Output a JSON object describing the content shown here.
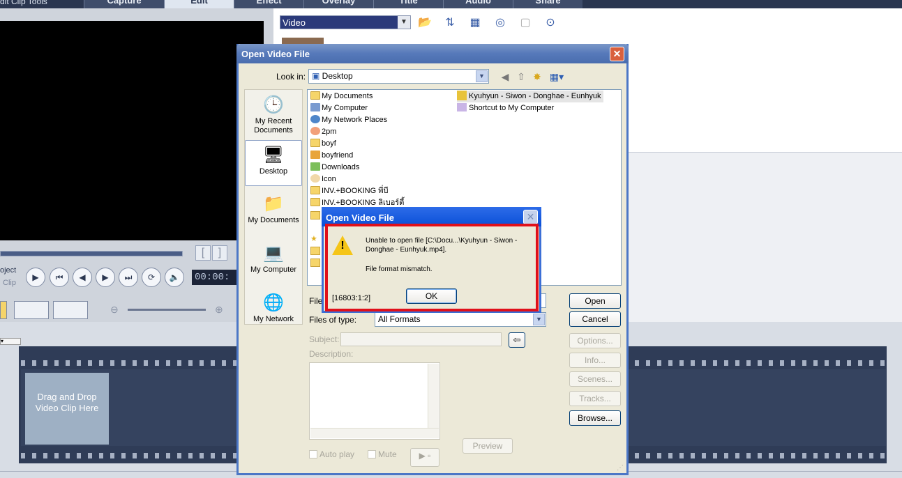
{
  "app": {
    "menu_text": "dit   Clip   Tools",
    "step_tabs": [
      "Capture",
      "Edit",
      "Effect",
      "Overlay",
      "Title",
      "Audio",
      "Share"
    ],
    "active_tab": "Edit",
    "project_label": "oject",
    "clip_label": "Clip",
    "timecode": "00:00:",
    "bracket_in": "[",
    "bracket_out": "]",
    "library_category": "Video",
    "drop_hint": "Drag and Drop Video Clip Here"
  },
  "dialog": {
    "title": "Open Video File",
    "look_in_label": "Look in:",
    "look_in_value": "Desktop",
    "places": [
      {
        "label": "My Recent Documents",
        "icon": "recent-documents-icon"
      },
      {
        "label": "Desktop",
        "icon": "desktop-icon"
      },
      {
        "label": "My Documents",
        "icon": "my-documents-icon"
      },
      {
        "label": "My Computer",
        "icon": "my-computer-icon"
      },
      {
        "label": "My Network",
        "icon": "my-network-icon"
      }
    ],
    "files_col1": [
      "My Documents",
      "My Computer",
      "My Network Places",
      "2pm",
      "boyf",
      "boyfriend",
      "Downloads",
      "Icon",
      "INV.+BOOKING พี่บี",
      "INV.+BOOKING ลิเบอร์ตี้"
    ],
    "files_col2": [
      "Kyuhyun - Siwon - Donghae - Eunhyuk",
      "Shortcut to My Computer"
    ],
    "file_name_label": "File",
    "files_of_type_label": "Files of type:",
    "files_of_type_value": "All Formats",
    "subject_label": "Subject:",
    "description_label": "Description:",
    "buttons": {
      "open": "Open",
      "cancel": "Cancel",
      "options": "Options...",
      "info": "Info...",
      "scenes": "Scenes...",
      "tracks": "Tracks...",
      "browse": "Browse...",
      "preview": "Preview"
    },
    "auto_play_label": "Auto play",
    "mute_label": "Mute"
  },
  "message_box": {
    "title": "Open Video File",
    "line1": "Unable to open file [C:\\Docu...\\Kyuhyun - Siwon - Donghae - Eunhyuk.mp4].",
    "line2": "File format mismatch.",
    "code": "[16803:1:2]",
    "ok_label": "OK"
  },
  "colors": {
    "highlight_box": "#e0101a",
    "title_bar": "#0a4fd8",
    "dialog_bg": "#ece9d8"
  }
}
